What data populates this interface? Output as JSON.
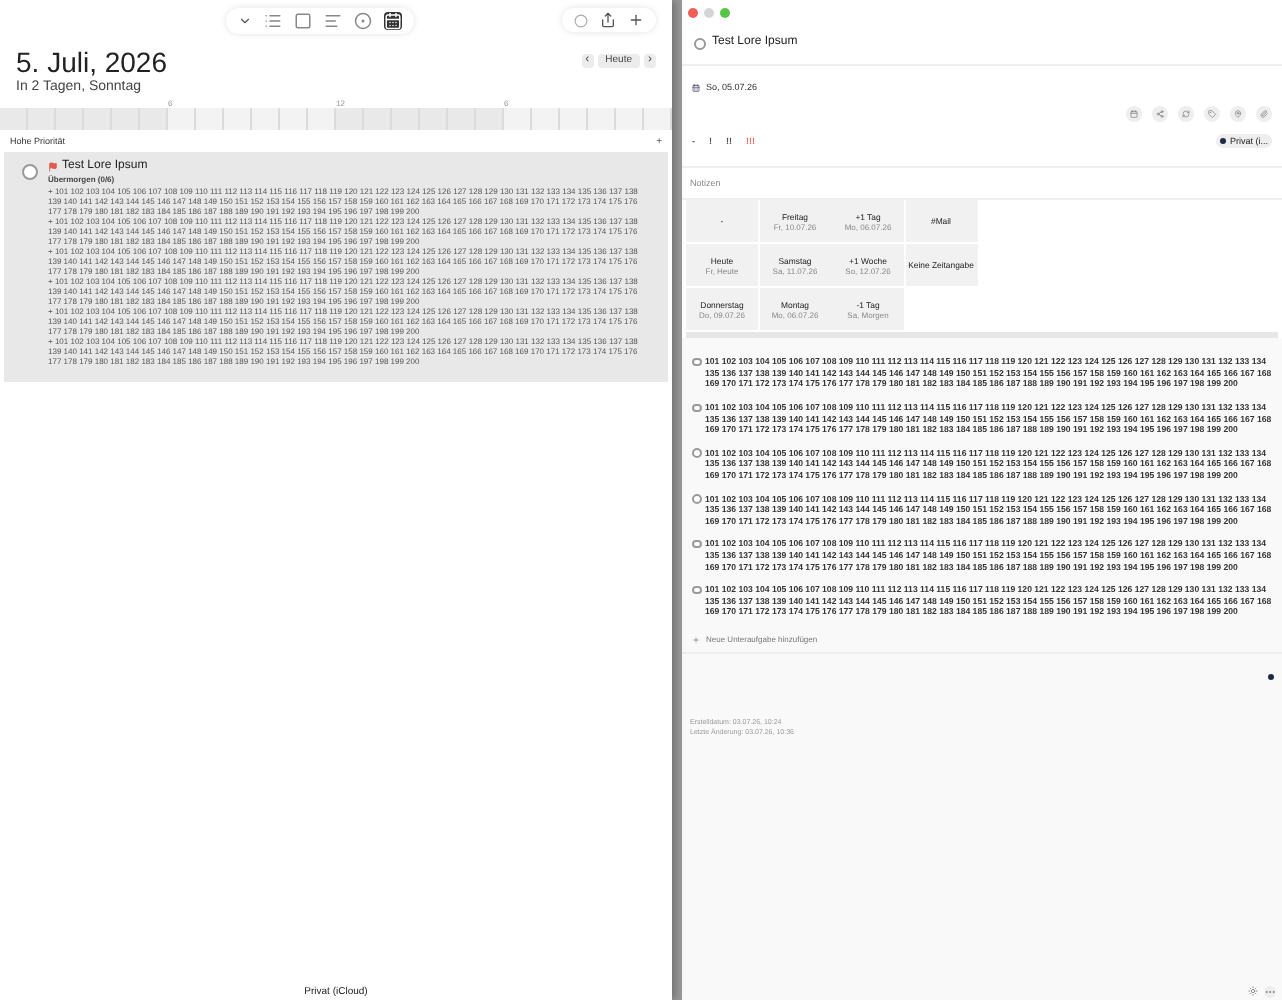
{
  "list_view": {
    "toolbar": {
      "views": [
        {
          "selected": false
        },
        {
          "selected": false
        },
        {
          "selected": false
        },
        {
          "selected": false
        },
        {
          "selected": true
        }
      ]
    },
    "date_title": "5. Juli, 2026",
    "date_subtitle": "In 2 Tagen, Sonntag",
    "nav": {
      "today": "Heute",
      "prev": "‹",
      "next": "›"
    },
    "timeline_ticks": [
      "6",
      "12",
      "6"
    ],
    "section": {
      "title": "Hohe Priorität",
      "add": "+"
    },
    "task": {
      "title": "Test Lore Ipsum",
      "checked": false,
      "due": "Übermorgen (0/6)",
      "notes": [
        "+ 101 102 103 104 105 106 107 108 109 110 111 112 113 114 115 116 117 118 119 120 121 122 123 124 125 126 127 128 129 130 131 132 133 134 135 136 137 138 139 140 141 142 143 144 145 146 147 148 149 150 151 152 153 154 155 156 157 158 159 160 161 162 163 164 165 166 167 168 169 170 171 172 173 174 175 176 177 178 179 180 181 182 183 184 185 186 187 188 189 190 191 192 193 194 195 196 197 198 199 200",
        "+ 101 102 103 104 105 106 107 108 109 110 111 112 113 114 115 116 117 118 119 120 121 122 123 124 125 126 127 128 129 130 131 132 133 134 135 136 137 138 139 140 141 142 143 144 145 146 147 148 149 150 151 152 153 154 155 156 157 158 159 160 161 162 163 164 165 166 167 168 169 170 171 172 173 174 175 176 177 178 179 180 181 182 183 184 185 186 187 188 189 190 191 192 193 194 195 196 197 198 199 200",
        "+ 101 102 103 104 105 106 107 108 109 110 111 112 113 114 115 116 117 118 119 120 121 122 123 124 125 126 127 128 129 130 131 132 133 134 135 136 137 138 139 140 141 142 143 144 145 146 147 148 149 150 151 152 153 154 155 156 157 158 159 160 161 162 163 164 165 166 167 168 169 170 171 172 173 174 175 176 177 178 179 180 181 182 183 184 185 186 187 188 189 190 191 192 193 194 195 196 197 198 199 200",
        "+ 101 102 103 104 105 106 107 108 109 110 111 112 113 114 115 116 117 118 119 120 121 122 123 124 125 126 127 128 129 130 131 132 133 134 135 136 137 138 139 140 141 142 143 144 145 146 147 148 149 150 151 152 153 154 155 156 157 158 159 160 161 162 163 164 165 166 167 168 169 170 171 172 173 174 175 176 177 178 179 180 181 182 183 184 185 186 187 188 189 190 191 192 193 194 195 196 197 198 199 200",
        "+ 101 102 103 104 105 106 107 108 109 110 111 112 113 114 115 116 117 118 119 120 121 122 123 124 125 126 127 128 129 130 131 132 133 134 135 136 137 138 139 140 141 142 143 144 145 146 147 148 149 150 151 152 153 154 155 156 157 158 159 160 161 162 163 164 165 166 167 168 169 170 171 172 173 174 175 176 177 178 179 180 181 182 183 184 185 186 187 188 189 190 191 192 193 194 195 196 197 198 199 200",
        "+ 101 102 103 104 105 106 107 108 109 110 111 112 113 114 115 116 117 118 119 120 121 122 123 124 125 126 127 128 129 130 131 132 133 134 135 136 137 138 139 140 141 142 143 144 145 146 147 148 149 150 151 152 153 154 155 156 157 158 159 160 161 162 163 164 165 166 167 168 169 170 171 172 173 174 175 176 177 178 179 180 181 182 183 184 185 186 187 188 189 190 191 192 193 194 195 196 197 198 199 200"
      ]
    },
    "footer": "Privat (iCloud)"
  },
  "detail": {
    "title": "Test Lore Ipsum",
    "checked": false,
    "date": "So, 05.07.26",
    "priorities": [
      {
        "label": "-",
        "selected": false
      },
      {
        "label": "!",
        "selected": false
      },
      {
        "label": "!!",
        "selected": false
      },
      {
        "label": "!!!",
        "selected": true
      }
    ],
    "list_chip": {
      "label": "Privat (i...",
      "color": "#1c2a44"
    },
    "notes_placeholder": "Notizen",
    "quick_dates": [
      {
        "label": "-"
      },
      {
        "label": "Freitag",
        "sublabel": "Fr, 10.07.26"
      },
      {
        "label": "+1 Tag",
        "sublabel": "Mo, 06.07.26"
      },
      {
        "label": "#Mail"
      },
      {
        "label": "Heute",
        "sublabel": "Fr, Heute"
      },
      {
        "label": "Samstag",
        "sublabel": "Sa, 11.07.26"
      },
      {
        "label": "+1 Woche",
        "sublabel": "So, 12.07.26"
      },
      {
        "label": "Keine Zeitangabe"
      },
      {
        "label": "Donnerstag",
        "sublabel": "Do, 09.07.26"
      },
      {
        "label": "Montag",
        "sublabel": "Mo, 06.07.26"
      },
      {
        "label": "-1 Tag",
        "sublabel": "Sa, Morgen"
      }
    ],
    "subtasks": [
      {
        "checked": false,
        "text": "101 102 103 104 105 106 107 108 109 110 111 112 113 114 115 116 117 118 119 120 121 122 123 124 125 126 127 128 129 130 131 132 133 134 135 136 137 138 139 140 141 142 143 144 145 146 147 148 149 150 151 152 153 154 155 156 157 158 159 160 161 162 163 164 165 166 167 168 169 170 171 172 173 174 175 176 177 178 179 180 181 182 183 184 185 186 187 188 189 190 191 192 193 194 195 196 197 198 199 200"
      },
      {
        "checked": false,
        "text": "101 102 103 104 105 106 107 108 109 110 111 112 113 114 115 116 117 118 119 120 121 122 123 124 125 126 127 128 129 130 131 132 133 134 135 136 137 138 139 140 141 142 143 144 145 146 147 148 149 150 151 152 153 154 155 156 157 158 159 160 161 162 163 164 165 166 167 168 169 170 171 172 173 174 175 176 177 178 179 180 181 182 183 184 185 186 187 188 189 190 191 192 193 194 195 196 197 198 199 200"
      },
      {
        "checked": false,
        "text": "101 102 103 104 105 106 107 108 109 110 111 112 113 114 115 116 117 118 119 120 121 122 123 124 125 126 127 128 129 130 131 132 133 134 135 136 137 138 139 140 141 142 143 144 145 146 147 148 149 150 151 152 153 154 155 156 157 158 159 160 161 162 163 164 165 166 167 168 169 170 171 172 173 174 175 176 177 178 179 180 181 182 183 184 185 186 187 188 189 190 191 192 193 194 195 196 197 198 199 200"
      },
      {
        "checked": false,
        "text": "101 102 103 104 105 106 107 108 109 110 111 112 113 114 115 116 117 118 119 120 121 122 123 124 125 126 127 128 129 130 131 132 133 134 135 136 137 138 139 140 141 142 143 144 145 146 147 148 149 150 151 152 153 154 155 156 157 158 159 160 161 162 163 164 165 166 167 168 169 170 171 172 173 174 175 176 177 178 179 180 181 182 183 184 185 186 187 188 189 190 191 192 193 194 195 196 197 198 199 200"
      },
      {
        "checked": false,
        "text": "101 102 103 104 105 106 107 108 109 110 111 112 113 114 115 116 117 118 119 120 121 122 123 124 125 126 127 128 129 130 131 132 133 134 135 136 137 138 139 140 141 142 143 144 145 146 147 148 149 150 151 152 153 154 155 156 157 158 159 160 161 162 163 164 165 166 167 168 169 170 171 172 173 174 175 176 177 178 179 180 181 182 183 184 185 186 187 188 189 190 191 192 193 194 195 196 197 198 199 200"
      },
      {
        "checked": false,
        "text": "101 102 103 104 105 106 107 108 109 110 111 112 113 114 115 116 117 118 119 120 121 122 123 124 125 126 127 128 129 130 131 132 133 134 135 136 137 138 139 140 141 142 143 144 145 146 147 148 149 150 151 152 153 154 155 156 157 158 159 160 161 162 163 164 165 166 167 168 169 170 171 172 173 174 175 176 177 178 179 180 181 182 183 184 185 186 187 188 189 190 191 192 193 194 195 196 197 198 199 200"
      }
    ],
    "add_subtask": "Neue Unteraufgabe hinzufügen",
    "created": "Erstelldatum: 03.07.26, 10:24",
    "modified": "Letzte Änderung: 03.07.26, 10:36"
  }
}
